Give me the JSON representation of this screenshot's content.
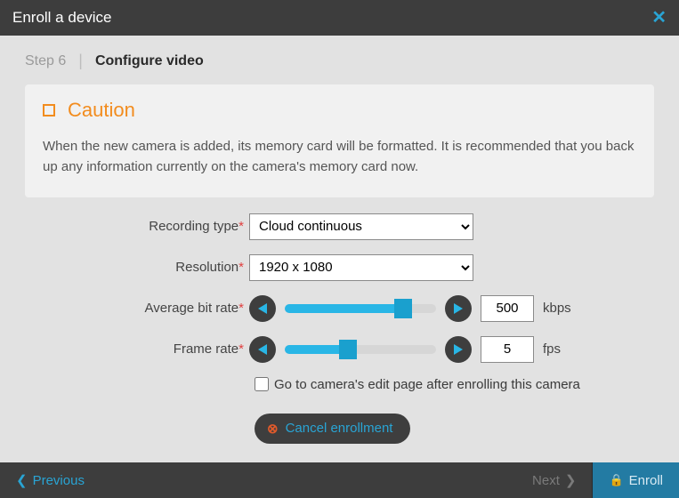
{
  "header": {
    "title": "Enroll a device"
  },
  "breadcrumb": {
    "step": "Step 6",
    "title": "Configure video"
  },
  "caution": {
    "title": "Caution",
    "text": "When the new camera is added, its memory card will be formatted. It is recommended that you back up any information currently on the camera's memory card now."
  },
  "form": {
    "recording_type": {
      "label": "Recording type",
      "value": "Cloud continuous"
    },
    "resolution": {
      "label": "Resolution",
      "value": "1920 x 1080"
    },
    "bitrate": {
      "label": "Average bit rate",
      "value": "500",
      "unit": "kbps",
      "fill_pct": 78
    },
    "framerate": {
      "label": "Frame rate",
      "value": "5",
      "unit": "fps",
      "fill_pct": 42
    },
    "goto_edit": {
      "label": "Go to camera's edit page after enrolling this camera",
      "checked": false
    },
    "cancel": {
      "label": "Cancel enrollment"
    }
  },
  "footer": {
    "previous": "Previous",
    "next": "Next",
    "enroll": "Enroll"
  }
}
